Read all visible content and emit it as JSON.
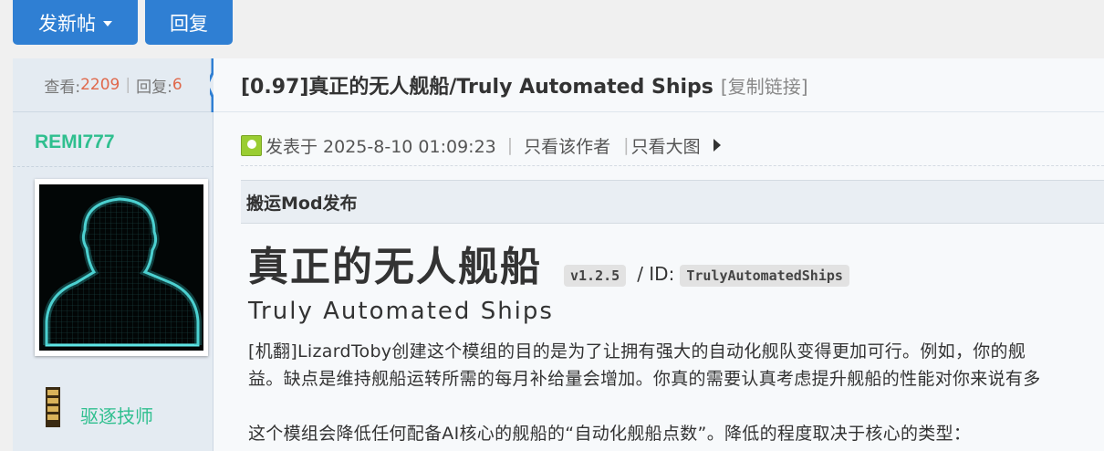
{
  "toolbar": {
    "new_post_label": "发新帖",
    "reply_label": "回复"
  },
  "stats": {
    "views_label": "查看:",
    "views": "2209",
    "replies_label": "回复:",
    "replies": "6"
  },
  "author": {
    "username": "REMI777",
    "rank_title": "驱逐技师",
    "avatar_icon": "silhouette-avatar"
  },
  "post": {
    "title": "[0.97]真正的无人舰船/Truly Automated Ships",
    "copy_link": "[复制链接]",
    "posted_label": "发表于 2025-8-10 01:09:23",
    "only_author": "只看该作者",
    "big_images": "只看大图",
    "section": "搬运Mod发布"
  },
  "content": {
    "heading": "真正的无人舰船",
    "version": "v1.2.5",
    "id_label": "/ ID:",
    "mod_id": "TrulyAutomatedShips",
    "subtitle": "Truly Automated Ships",
    "para1": "[机翻]LizardToby创建这个模组的目的是为了让拥有强大的自动化舰队变得更加可行。例如，你的舰",
    "para2": "益。缺点是维持舰船运转所需的每月补给量会增加。你真的需要认真考虑提升舰船的性能对你来说有多",
    "para3": "这个模组会降低任何配备AI核心的舰船的“自动化舰船点数”。降低的程度取决于核心的类型："
  },
  "colors": {
    "accent": "#2f7fd3",
    "username": "#2fbf8f",
    "count": "#e0684b"
  }
}
